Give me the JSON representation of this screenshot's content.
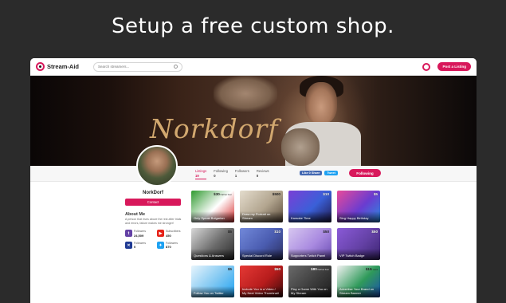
{
  "headline": "Setup a free custom shop.",
  "brand": {
    "name": "Stream-Aid",
    "accent": "#d8185b"
  },
  "search": {
    "placeholder": "Search streamers..."
  },
  "topbar": {
    "post_label": "Post a Listing"
  },
  "banner": {
    "name": "Norkdorf"
  },
  "stats": [
    {
      "label": "Listings",
      "value": "19"
    },
    {
      "label": "Following",
      "value": "0"
    },
    {
      "label": "Followers",
      "value": "1"
    },
    {
      "label": "Reviews",
      "value": "0"
    }
  ],
  "social_buttons": {
    "facebook": "Like 0 Share",
    "twitter": "Tweet"
  },
  "follow_label": "Following",
  "profile": {
    "name": "NorkDorf",
    "contact_label": "Contact",
    "about_title": "About Me",
    "about_text": "A person that rises above the rest after trials and errors, failure makes me stronger!"
  },
  "socials": [
    {
      "label": "Followers",
      "value": "24,509",
      "icon": "twitch-icon",
      "color": "#6441a5",
      "glyph": "t"
    },
    {
      "label": "Subscribers",
      "value": "450",
      "icon": "youtube-icon",
      "color": "#e62117",
      "glyph": "▶"
    },
    {
      "label": "Followers",
      "value": "0",
      "icon": "mixer-icon",
      "color": "#1f3a93",
      "glyph": "✕"
    },
    {
      "label": "Followers",
      "value": "870",
      "icon": "twitter-icon",
      "color": "#1da1f2",
      "glyph": "✦"
    }
  ],
  "listings": [
    {
      "title": "Only Speak Bulgarian",
      "price": "$30",
      "price_note": "/ half an hour",
      "colors": [
        "#2f9a2f",
        "#ffffff",
        "#d62f2f"
      ],
      "light_price": true
    },
    {
      "title": "Draw my Portrait on Stream",
      "price": "$500",
      "price_note": "",
      "colors": [
        "#e4dccd",
        "#b2a58f",
        "#5a4a3a"
      ],
      "light_price": true
    },
    {
      "title": "Karaoke Time",
      "price": "$10",
      "price_note": "",
      "colors": [
        "#7a3fd6",
        "#3a60d8",
        "#211a4e"
      ],
      "light_price": false
    },
    {
      "title": "Sing Happy Birthday",
      "price": "$5",
      "price_note": "",
      "colors": [
        "#e84a9a",
        "#6a3cd0",
        "#2a8de0"
      ],
      "light_price": false
    },
    {
      "title": "Questions & Answers",
      "price": "$5",
      "price_note": "",
      "colors": [
        "#d8d8d8",
        "#6a6a6a",
        "#2b2b2b"
      ],
      "light_price": true
    },
    {
      "title": "Special Discord Role",
      "price": "$10",
      "price_note": "",
      "colors": [
        "#7289da",
        "#4a5cb0",
        "#2c2f60"
      ],
      "light_price": false
    },
    {
      "title": "Supporters Twitch Panel",
      "price": "$50",
      "price_note": "",
      "colors": [
        "#d7c7f0",
        "#a98ae0",
        "#6a4cb3"
      ],
      "light_price": true
    },
    {
      "title": "VIP Twitch Badge",
      "price": "$50",
      "price_note": "",
      "colors": [
        "#8a5ad8",
        "#6441a5",
        "#3b2470"
      ],
      "light_price": false
    },
    {
      "title": "Follow You on Twitter",
      "price": "$5",
      "price_note": "",
      "colors": [
        "#e7f4fc",
        "#7cc6f2",
        "#1da1f2"
      ],
      "light_price": true
    },
    {
      "title": "Include You in a Video / My Next Video Thumbnail",
      "price": "$50",
      "price_note": "",
      "colors": [
        "#e53935",
        "#b71c1c",
        "#3a0b0b"
      ],
      "light_price": false
    },
    {
      "title": "Play a Game With You on My Stream",
      "price": "$80",
      "price_note": "/ half an hour",
      "colors": [
        "#6a6a6a",
        "#3d3d3d",
        "#1b1b1b"
      ],
      "light_price": false
    },
    {
      "title": "Advertise Your Brand on Stream Banner",
      "price": "$19",
      "price_note": "/ week",
      "colors": [
        "#f2f2f2",
        "#2f9a5a",
        "#1b4fb0"
      ],
      "light_price": true
    }
  ]
}
